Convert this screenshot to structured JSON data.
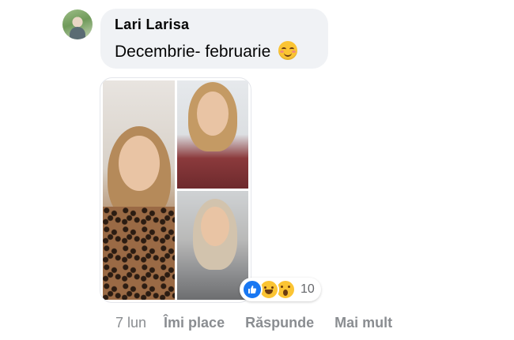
{
  "comment": {
    "author": "Lari Larisa",
    "text": "Decembrie- februarie",
    "emoji_icon": "smiling-face-with-blush-icon"
  },
  "photos": [
    {
      "name": "photo-left",
      "icon": "photo"
    },
    {
      "name": "photo-top-right",
      "icon": "photo"
    },
    {
      "name": "photo-bottom-right",
      "icon": "photo"
    }
  ],
  "reactions": {
    "icons": [
      "like-reaction-icon",
      "haha-reaction-icon",
      "wow-reaction-icon"
    ],
    "count": "10",
    "like_color": "#1877f2",
    "emoji_color": "#fbc433"
  },
  "actions": {
    "timestamp": "7 lun",
    "like_label": "Îmi place",
    "reply_label": "Răspunde",
    "more_label": "Mai mult"
  },
  "colors": {
    "bubble_bg": "#f0f2f5",
    "secondary_text": "#8a8d91"
  }
}
